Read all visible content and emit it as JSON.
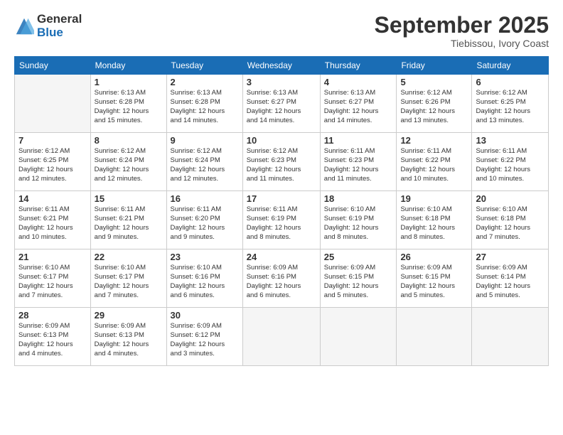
{
  "logo": {
    "general": "General",
    "blue": "Blue"
  },
  "header": {
    "month": "September 2025",
    "location": "Tiebissou, Ivory Coast"
  },
  "days_of_week": [
    "Sunday",
    "Monday",
    "Tuesday",
    "Wednesday",
    "Thursday",
    "Friday",
    "Saturday"
  ],
  "weeks": [
    [
      {
        "day": "",
        "info": ""
      },
      {
        "day": "1",
        "info": "Sunrise: 6:13 AM\nSunset: 6:28 PM\nDaylight: 12 hours\nand 15 minutes."
      },
      {
        "day": "2",
        "info": "Sunrise: 6:13 AM\nSunset: 6:28 PM\nDaylight: 12 hours\nand 14 minutes."
      },
      {
        "day": "3",
        "info": "Sunrise: 6:13 AM\nSunset: 6:27 PM\nDaylight: 12 hours\nand 14 minutes."
      },
      {
        "day": "4",
        "info": "Sunrise: 6:13 AM\nSunset: 6:27 PM\nDaylight: 12 hours\nand 14 minutes."
      },
      {
        "day": "5",
        "info": "Sunrise: 6:12 AM\nSunset: 6:26 PM\nDaylight: 12 hours\nand 13 minutes."
      },
      {
        "day": "6",
        "info": "Sunrise: 6:12 AM\nSunset: 6:25 PM\nDaylight: 12 hours\nand 13 minutes."
      }
    ],
    [
      {
        "day": "7",
        "info": "Sunrise: 6:12 AM\nSunset: 6:25 PM\nDaylight: 12 hours\nand 12 minutes."
      },
      {
        "day": "8",
        "info": "Sunrise: 6:12 AM\nSunset: 6:24 PM\nDaylight: 12 hours\nand 12 minutes."
      },
      {
        "day": "9",
        "info": "Sunrise: 6:12 AM\nSunset: 6:24 PM\nDaylight: 12 hours\nand 12 minutes."
      },
      {
        "day": "10",
        "info": "Sunrise: 6:12 AM\nSunset: 6:23 PM\nDaylight: 12 hours\nand 11 minutes."
      },
      {
        "day": "11",
        "info": "Sunrise: 6:11 AM\nSunset: 6:23 PM\nDaylight: 12 hours\nand 11 minutes."
      },
      {
        "day": "12",
        "info": "Sunrise: 6:11 AM\nSunset: 6:22 PM\nDaylight: 12 hours\nand 10 minutes."
      },
      {
        "day": "13",
        "info": "Sunrise: 6:11 AM\nSunset: 6:22 PM\nDaylight: 12 hours\nand 10 minutes."
      }
    ],
    [
      {
        "day": "14",
        "info": "Sunrise: 6:11 AM\nSunset: 6:21 PM\nDaylight: 12 hours\nand 10 minutes."
      },
      {
        "day": "15",
        "info": "Sunrise: 6:11 AM\nSunset: 6:21 PM\nDaylight: 12 hours\nand 9 minutes."
      },
      {
        "day": "16",
        "info": "Sunrise: 6:11 AM\nSunset: 6:20 PM\nDaylight: 12 hours\nand 9 minutes."
      },
      {
        "day": "17",
        "info": "Sunrise: 6:11 AM\nSunset: 6:19 PM\nDaylight: 12 hours\nand 8 minutes."
      },
      {
        "day": "18",
        "info": "Sunrise: 6:10 AM\nSunset: 6:19 PM\nDaylight: 12 hours\nand 8 minutes."
      },
      {
        "day": "19",
        "info": "Sunrise: 6:10 AM\nSunset: 6:18 PM\nDaylight: 12 hours\nand 8 minutes."
      },
      {
        "day": "20",
        "info": "Sunrise: 6:10 AM\nSunset: 6:18 PM\nDaylight: 12 hours\nand 7 minutes."
      }
    ],
    [
      {
        "day": "21",
        "info": "Sunrise: 6:10 AM\nSunset: 6:17 PM\nDaylight: 12 hours\nand 7 minutes."
      },
      {
        "day": "22",
        "info": "Sunrise: 6:10 AM\nSunset: 6:17 PM\nDaylight: 12 hours\nand 7 minutes."
      },
      {
        "day": "23",
        "info": "Sunrise: 6:10 AM\nSunset: 6:16 PM\nDaylight: 12 hours\nand 6 minutes."
      },
      {
        "day": "24",
        "info": "Sunrise: 6:09 AM\nSunset: 6:16 PM\nDaylight: 12 hours\nand 6 minutes."
      },
      {
        "day": "25",
        "info": "Sunrise: 6:09 AM\nSunset: 6:15 PM\nDaylight: 12 hours\nand 5 minutes."
      },
      {
        "day": "26",
        "info": "Sunrise: 6:09 AM\nSunset: 6:15 PM\nDaylight: 12 hours\nand 5 minutes."
      },
      {
        "day": "27",
        "info": "Sunrise: 6:09 AM\nSunset: 6:14 PM\nDaylight: 12 hours\nand 5 minutes."
      }
    ],
    [
      {
        "day": "28",
        "info": "Sunrise: 6:09 AM\nSunset: 6:13 PM\nDaylight: 12 hours\nand 4 minutes."
      },
      {
        "day": "29",
        "info": "Sunrise: 6:09 AM\nSunset: 6:13 PM\nDaylight: 12 hours\nand 4 minutes."
      },
      {
        "day": "30",
        "info": "Sunrise: 6:09 AM\nSunset: 6:12 PM\nDaylight: 12 hours\nand 3 minutes."
      },
      {
        "day": "",
        "info": ""
      },
      {
        "day": "",
        "info": ""
      },
      {
        "day": "",
        "info": ""
      },
      {
        "day": "",
        "info": ""
      }
    ]
  ]
}
